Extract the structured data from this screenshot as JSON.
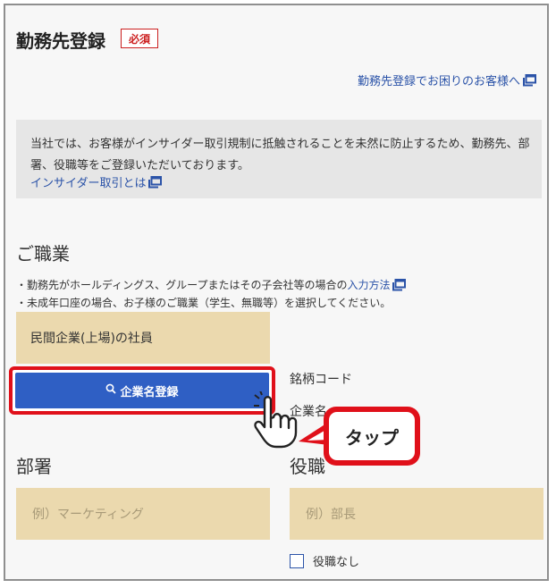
{
  "header": {
    "title": "勤務先登録",
    "required_badge": "必須",
    "help_link": "勤務先登録でお困りのお客様へ"
  },
  "notice": {
    "text": "当社では、お客様がインサイダー取引規制に抵触されることを未然に防止するため、勤務先、部署、役職等をご登録いただいております。",
    "link": "インサイダー取引とは"
  },
  "occupation": {
    "heading": "ご職業",
    "note1_prefix": "・勤務先がホールディングス、グループまたはその子会社等の場合の",
    "note1_link": "入力方法",
    "note2": "・未成年口座の場合、お子様のご職業（学生、無職等）を選択してください。",
    "selected_value": "民間企業(上場)の社員"
  },
  "company": {
    "button_label": "企業名登録",
    "stock_code_label": "銘柄コード",
    "company_name_label": "企業名"
  },
  "department": {
    "heading": "部署",
    "placeholder": "例）マーケティング"
  },
  "position": {
    "heading": "役職",
    "placeholder": "例）部長",
    "none_label": "役職なし"
  },
  "callout": {
    "text": "タップ"
  },
  "colors": {
    "accent_blue": "#2f5fc4",
    "link_blue": "#2b53a8",
    "highlight_red": "#e0101a",
    "field_tan": "#ebd9ae"
  },
  "icons": [
    "external-link-icon",
    "search-icon",
    "pointing-hand-icon"
  ]
}
